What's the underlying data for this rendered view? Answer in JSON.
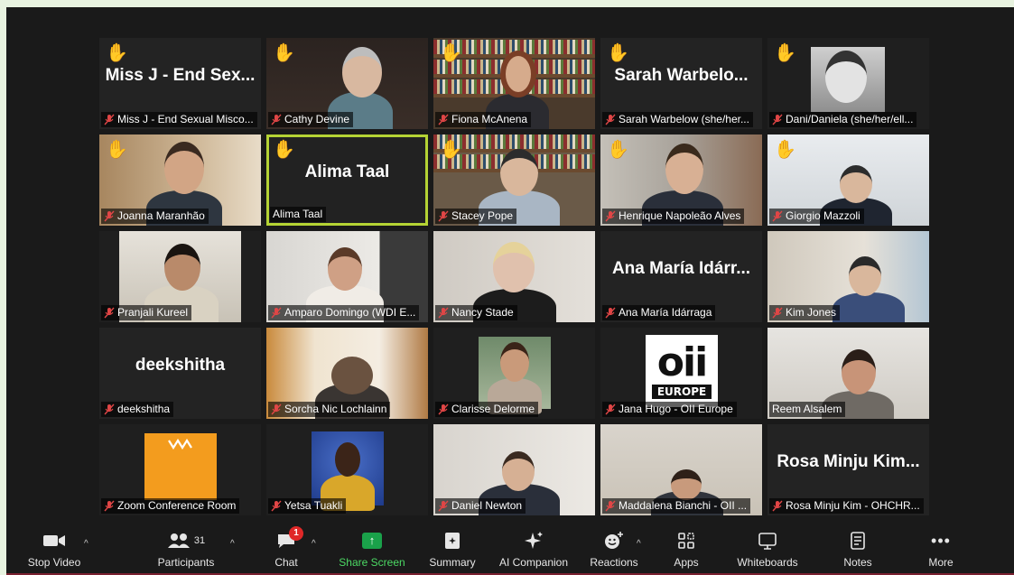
{
  "participants_grid": [
    [
      {
        "name": "Miss J - End Sexual Misco...",
        "display_name": "Miss J - End Sex...",
        "hand": "yellow",
        "video": false
      },
      {
        "name": "Cathy Devine",
        "hand": "yellow",
        "video": true
      },
      {
        "name": "Fiona McAnena",
        "hand": "yellow",
        "video": true
      },
      {
        "name": "Sarah Warbelow (she/her...",
        "display_name": "Sarah Warbelo...",
        "hand": "yellow",
        "video": false
      },
      {
        "name": "Dani/Daniela (she/her/ell...",
        "hand": "brown",
        "video": true
      }
    ],
    [
      {
        "name": "Joanna Maranhão",
        "hand": "yellow",
        "video": true
      },
      {
        "name": "Alima Taal",
        "display_name": "Alima Taal",
        "hand": "yellow",
        "video": false,
        "active_speaker": true
      },
      {
        "name": "Stacey Pope",
        "hand": "yellow",
        "video": true
      },
      {
        "name": "Henrique Napoleão Alves",
        "hand": "yellow",
        "video": true
      },
      {
        "name": "Giorgio Mazzoli",
        "hand": "yellow",
        "video": true
      }
    ],
    [
      {
        "name": "Pranjali Kureel",
        "video": true
      },
      {
        "name": "Amparo Domingo (WDI E...",
        "video": true
      },
      {
        "name": "Nancy Stade",
        "video": true
      },
      {
        "name": "Ana María Idárraga",
        "display_name": "Ana María Idárr...",
        "video": false
      },
      {
        "name": "Kim Jones",
        "video": true
      }
    ],
    [
      {
        "name": "deekshitha",
        "display_name": "deekshitha",
        "video": false
      },
      {
        "name": "Sorcha Nic Lochlainn",
        "video": true
      },
      {
        "name": "Clarisse Delorme",
        "video": true
      },
      {
        "name": "Jana Hugo - OII Europe",
        "video": true,
        "logo": "oii EUROPE"
      },
      {
        "name": "Reem Alsalem",
        "video": true
      }
    ],
    [
      {
        "name": "Zoom Conference Room",
        "video": true
      },
      {
        "name": "Yetsa Tuakli",
        "video": true
      },
      {
        "name": "Daniel Newton",
        "video": true
      },
      {
        "name": "Maddalena Bianchi - OII ...",
        "video": true
      },
      {
        "name": "Rosa Minju Kim - OHCHR...",
        "display_name": "Rosa Minju Kim...",
        "video": false
      }
    ]
  ],
  "logo_text": {
    "oii": "oii",
    "europe": "EUROPE"
  },
  "toolbar": {
    "stop_video": "Stop Video",
    "participants": "Participants",
    "participants_count": "31",
    "chat": "Chat",
    "chat_badge": "1",
    "share_screen": "Share Screen",
    "summary": "Summary",
    "ai_companion": "AI Companion",
    "reactions": "Reactions",
    "apps": "Apps",
    "whiteboards": "Whiteboards",
    "notes": "Notes",
    "more": "More"
  },
  "colors": {
    "speaker_border": "#b5d334",
    "share_green": "#1aa14a",
    "hand_yellow": "#f6c344",
    "badge_red": "#e02828"
  }
}
